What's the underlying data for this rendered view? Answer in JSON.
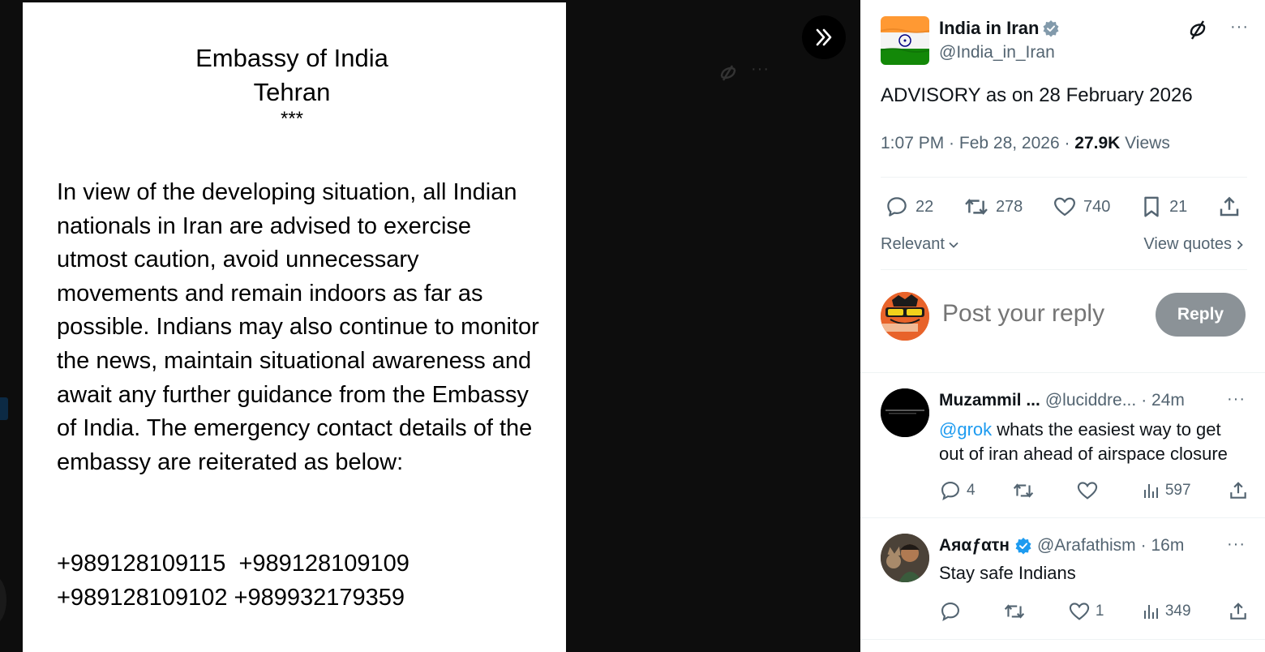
{
  "document": {
    "header_line1": "Embassy of India",
    "header_line2": "Tehran",
    "stars": "***",
    "body": "In view of the developing situation, all Indian nationals in Iran are advised to exercise utmost caution, avoid unnecessary movements and remain indoors as far as possible. Indians may also continue to monitor the news, maintain situational awareness and await any further guidance from the Embassy of India. The emergency contact details of the embassy are reiterated as below:",
    "phones_line1": "+989128109115  +989128109109",
    "phones_line2": "+989128109102 +989932179359"
  },
  "tweet": {
    "author_name": "India in Iran",
    "author_handle": "@India_in_Iran",
    "text": "ADVISORY as on 28 February 2026",
    "time": "1:07 PM · Feb 28, 2026 · ",
    "views_count": "27.9K",
    "views_label": " Views",
    "replies": "22",
    "reposts": "278",
    "likes": "740",
    "bookmarks": "21"
  },
  "sort": {
    "relevant_label": "Relevant",
    "view_quotes_label": "View quotes"
  },
  "reply_composer": {
    "placeholder": "Post your reply",
    "button_label": "Reply"
  },
  "replies": [
    {
      "name": "Muzammil ...",
      "handle": "@luciddre...",
      "time": "· 24m",
      "mention": "@grok",
      "text": " whats the easiest way to get out of iran ahead of airspace closure",
      "replies": "4",
      "reposts": "",
      "likes": "",
      "views": "597"
    },
    {
      "name": "Aяαƒατн",
      "handle": "@Arafathism",
      "time": "· 16m",
      "text": "Stay safe Indians",
      "replies": "",
      "reposts": "",
      "likes": "1",
      "views": "349"
    }
  ],
  "colors": {
    "accent": "#1d9bf0",
    "muted": "#536471",
    "reply_button": "#8b9297"
  }
}
